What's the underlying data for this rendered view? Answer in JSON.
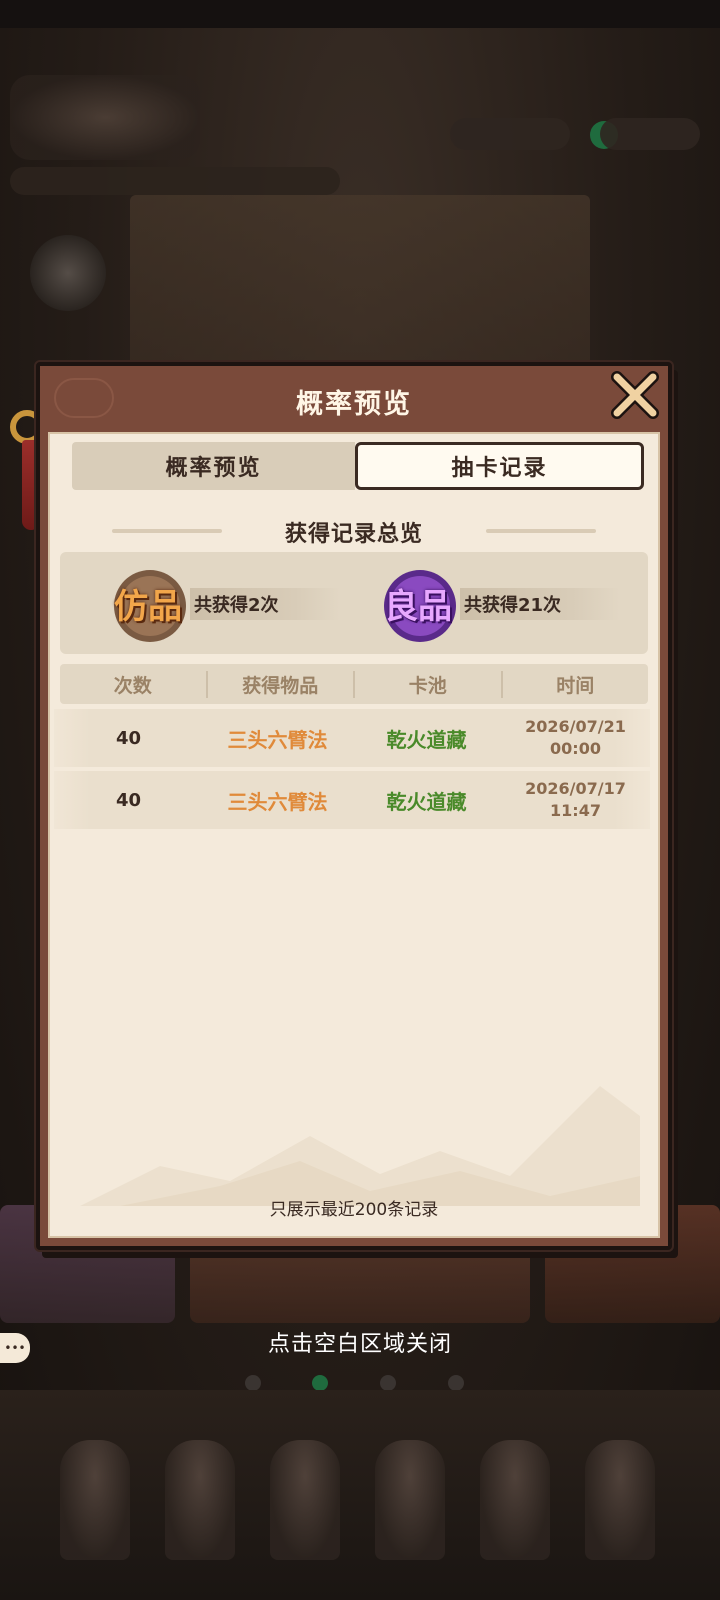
{
  "modal": {
    "title": "概率预览",
    "tabs": [
      {
        "label": "概率预览",
        "active": false
      },
      {
        "label": "抽卡记录",
        "active": true
      }
    ],
    "section_title": "获得记录总览",
    "summary": [
      {
        "badge": "仿品",
        "badge_color": "#e59a3a",
        "text": "共获得2次"
      },
      {
        "badge": "良品",
        "badge_color": "#b65ae0",
        "text": "共获得21次"
      }
    ],
    "table": {
      "headers": [
        "次数",
        "获得物品",
        "卡池",
        "时间"
      ],
      "rows": [
        {
          "count": "40",
          "item": "三头六臂法",
          "pool": "乾火道藏",
          "date": "2026/07/21",
          "time": "00:00"
        },
        {
          "count": "40",
          "item": "三头六臂法",
          "pool": "乾火道藏",
          "date": "2026/07/17",
          "time": "11:47"
        }
      ]
    },
    "footnote": "只展示最近200条记录"
  },
  "close_hint": "点击空白区域关闭",
  "colors": {
    "panel_header": "#7a4a3a",
    "panel_body": "#f4eadb",
    "item_text": "#e08a3a",
    "pool_text": "#4a8a2a"
  },
  "icons": [
    "close-x-icon",
    "tassel-icon",
    "chat-bubble-icon"
  ]
}
